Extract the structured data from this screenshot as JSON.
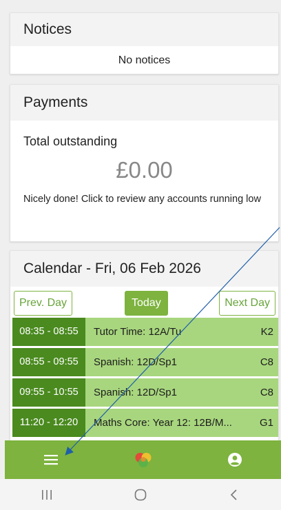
{
  "notices": {
    "title": "Notices",
    "empty_text": "No notices"
  },
  "payments": {
    "title": "Payments",
    "total_label": "Total outstanding",
    "amount": "£0.00",
    "message": "Nicely done! Click to review any accounts running low"
  },
  "calendar": {
    "title": "Calendar - Fri, 06 Feb 2026",
    "prev_label": "Prev. Day",
    "today_label": "Today",
    "next_label": "Next Day",
    "lessons": [
      {
        "time": "08:35 - 08:55",
        "subject": "Tutor Time: 12A/Tu",
        "room": "K2"
      },
      {
        "time": "08:55 - 09:55",
        "subject": "Spanish: 12D/Sp1",
        "room": "C8"
      },
      {
        "time": "09:55 - 10:55",
        "subject": "Spanish: 12D/Sp1",
        "room": "C8"
      },
      {
        "time": "11:20 - 12:20",
        "subject": "Maths Core: Year 12: 12B/M...",
        "room": "G1"
      }
    ]
  },
  "bottom_nav": {
    "icons": [
      "menu-icon",
      "app-logo-icon",
      "account-icon"
    ]
  },
  "system_bar": {
    "icons": [
      "recents-icon",
      "home-icon",
      "back-icon"
    ]
  },
  "colors": {
    "brand_green": "#7db33e",
    "time_green": "#4a8a1f",
    "lesson_green": "#a8d67e"
  }
}
